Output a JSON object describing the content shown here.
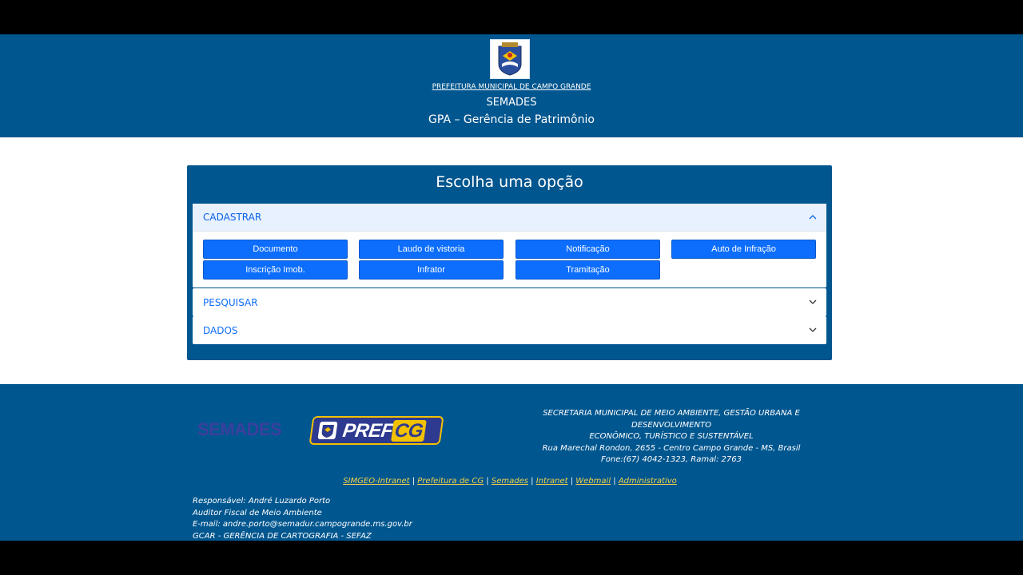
{
  "header": {
    "crest_icon": "city-coat-of-arms-icon",
    "org_link": "PREFEITURA MUNICIPAL DE CAMPO GRANDE",
    "subtitle": "SEMADES",
    "title": "GPA – Gerência de Patrimônio"
  },
  "panel": {
    "title": "Escolha uma opção",
    "sections": [
      {
        "label": "CADASTRAR",
        "expanded": true,
        "buttons": [
          "Documento",
          "Laudo de vistoria",
          "Notificação",
          "Auto de Infração",
          "Inscrição Imob.",
          "Infrator",
          "Tramitação"
        ]
      },
      {
        "label": "PESQUISAR",
        "expanded": false
      },
      {
        "label": "DADOS",
        "expanded": false
      }
    ]
  },
  "footer": {
    "logo_semades": "SEMADES",
    "logo_pref": "PREF",
    "logo_cg": "CG",
    "address_lines": [
      "SECRETARIA MUNICIPAL DE MEIO AMBIENTE, GESTÃO URBANA E DESENVOLVIMENTO",
      "ECONÔMICO, TURÍSTICO E SUSTENTÁVEL",
      "Rua Marechal Rondon, 2655 - Centro Campo Grande - MS, Brasil",
      "Fone:(67) 4042-1323, Ramal: 2763"
    ],
    "links": [
      "SIMGEO-Intranet",
      "Prefeitura de CG",
      "Semades",
      "Intranet",
      "Webmail",
      "Administrativo"
    ],
    "link_separator": " | ",
    "responsible_lines": [
      "Responsável: André Luzardo Porto",
      "Auditor Fiscal de Meio Ambiente",
      "E-mail: andre.porto@semadur.campogrande.ms.gov.br",
      "GCAR - GERÊNCIA DE CARTOGRAFIA - SEFAZ"
    ]
  },
  "colors": {
    "brand_blue": "#00568f",
    "button_blue": "#0d6efd",
    "link_yellow": "#f2d24a"
  }
}
